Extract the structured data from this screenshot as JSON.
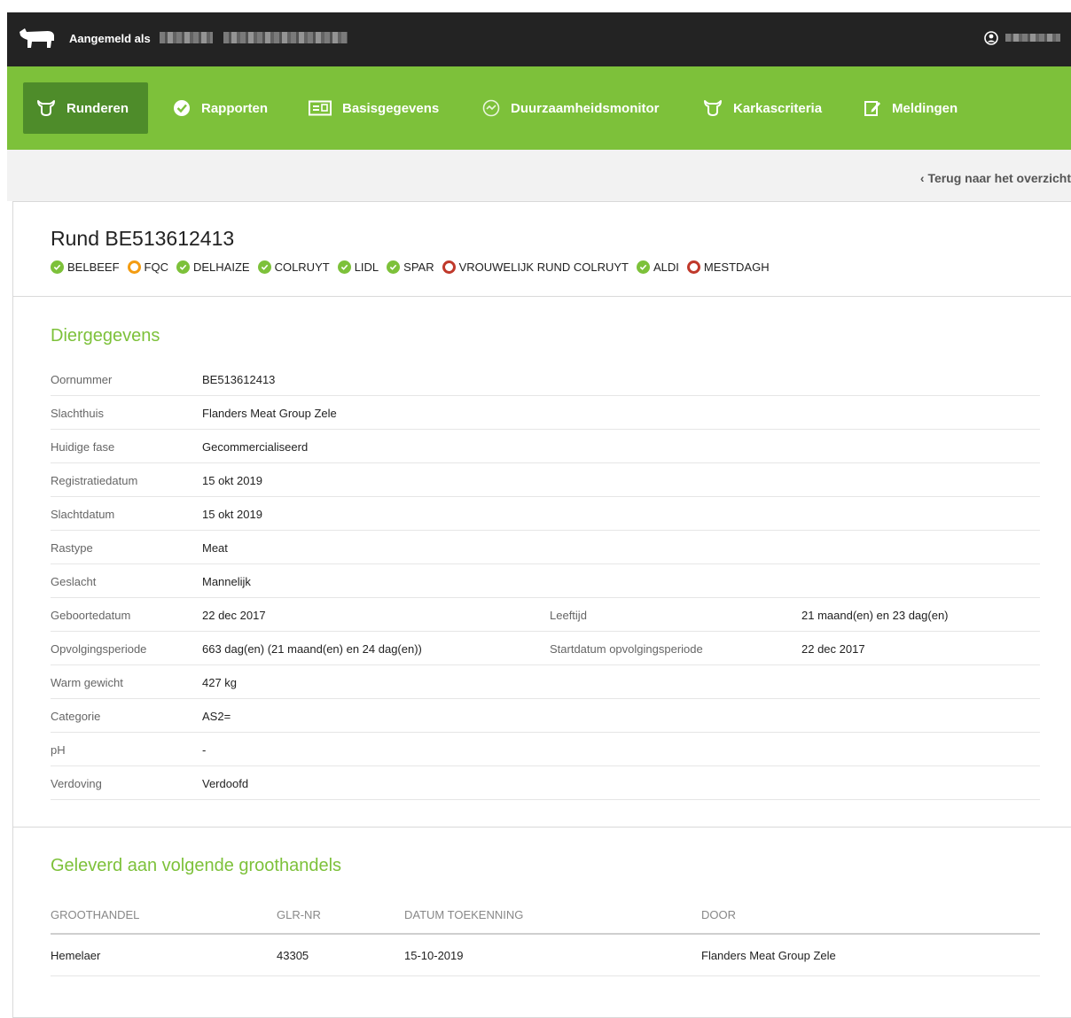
{
  "header": {
    "logged_in_label": "Aangemeld als"
  },
  "nav": {
    "items": [
      {
        "label": "Runderen",
        "icon": "cow-head-icon",
        "active": true
      },
      {
        "label": "Rapporten",
        "icon": "check-circle-icon",
        "active": false
      },
      {
        "label": "Basisgegevens",
        "icon": "id-card-icon",
        "active": false
      },
      {
        "label": "Duurzaamheidsmonitor",
        "icon": "gauge-icon",
        "active": false
      },
      {
        "label": "Karkascriteria",
        "icon": "cow-head-icon",
        "active": false
      },
      {
        "label": "Meldingen",
        "icon": "edit-note-icon",
        "active": false
      }
    ]
  },
  "back_link": "Terug naar het overzicht",
  "animal": {
    "title": "Rund BE513612413",
    "labels": [
      {
        "name": "BELBEEF",
        "status": "ok"
      },
      {
        "name": "FQC",
        "status": "warn"
      },
      {
        "name": "DELHAIZE",
        "status": "ok"
      },
      {
        "name": "COLRUYT",
        "status": "ok"
      },
      {
        "name": "LIDL",
        "status": "ok"
      },
      {
        "name": "SPAR",
        "status": "ok"
      },
      {
        "name": "VROUWELIJK RUND COLRUYT",
        "status": "fail"
      },
      {
        "name": "ALDI",
        "status": "ok"
      },
      {
        "name": "MESTDAGH",
        "status": "fail"
      }
    ]
  },
  "details": {
    "title": "Diergegevens",
    "rows": [
      {
        "label": "Oornummer",
        "value": "BE513612413"
      },
      {
        "label": "Slachthuis",
        "value": "Flanders Meat Group Zele"
      },
      {
        "label": "Huidige fase",
        "value": "Gecommercialiseerd"
      },
      {
        "label": "Registratiedatum",
        "value": "15 okt 2019"
      },
      {
        "label": "Slachtdatum",
        "value": "15 okt 2019"
      },
      {
        "label": "Rastype",
        "value": "Meat"
      },
      {
        "label": "Geslacht",
        "value": "Mannelijk"
      },
      {
        "label": "Geboortedatum",
        "value": "22 dec 2017",
        "label2": "Leeftijd",
        "value2": "21 maand(en) en 23 dag(en)"
      },
      {
        "label": "Opvolgingsperiode",
        "value": "663 dag(en) (21 maand(en) en 24 dag(en))",
        "label2": "Startdatum opvolgingsperiode",
        "value2": "22 dec 2017"
      },
      {
        "label": "Warm gewicht",
        "value": "427 kg"
      },
      {
        "label": "Categorie",
        "value": "AS2="
      },
      {
        "label": "pH",
        "value": "-"
      },
      {
        "label": "Verdoving",
        "value": "Verdoofd"
      }
    ]
  },
  "wholesalers": {
    "title": "Geleverd aan volgende groothandels",
    "columns": [
      "GROOTHANDEL",
      "GLR-NR",
      "DATUM TOEKENNING",
      "DOOR"
    ],
    "rows": [
      [
        "Hemelaer",
        "43305",
        "15-10-2019",
        "Flanders Meat Group Zele"
      ]
    ]
  },
  "colors": {
    "nav_green": "#7dc13a",
    "nav_active": "#4e8c2a",
    "ok": "#7dc13a",
    "warn": "#f39c12",
    "fail": "#c0392b"
  }
}
